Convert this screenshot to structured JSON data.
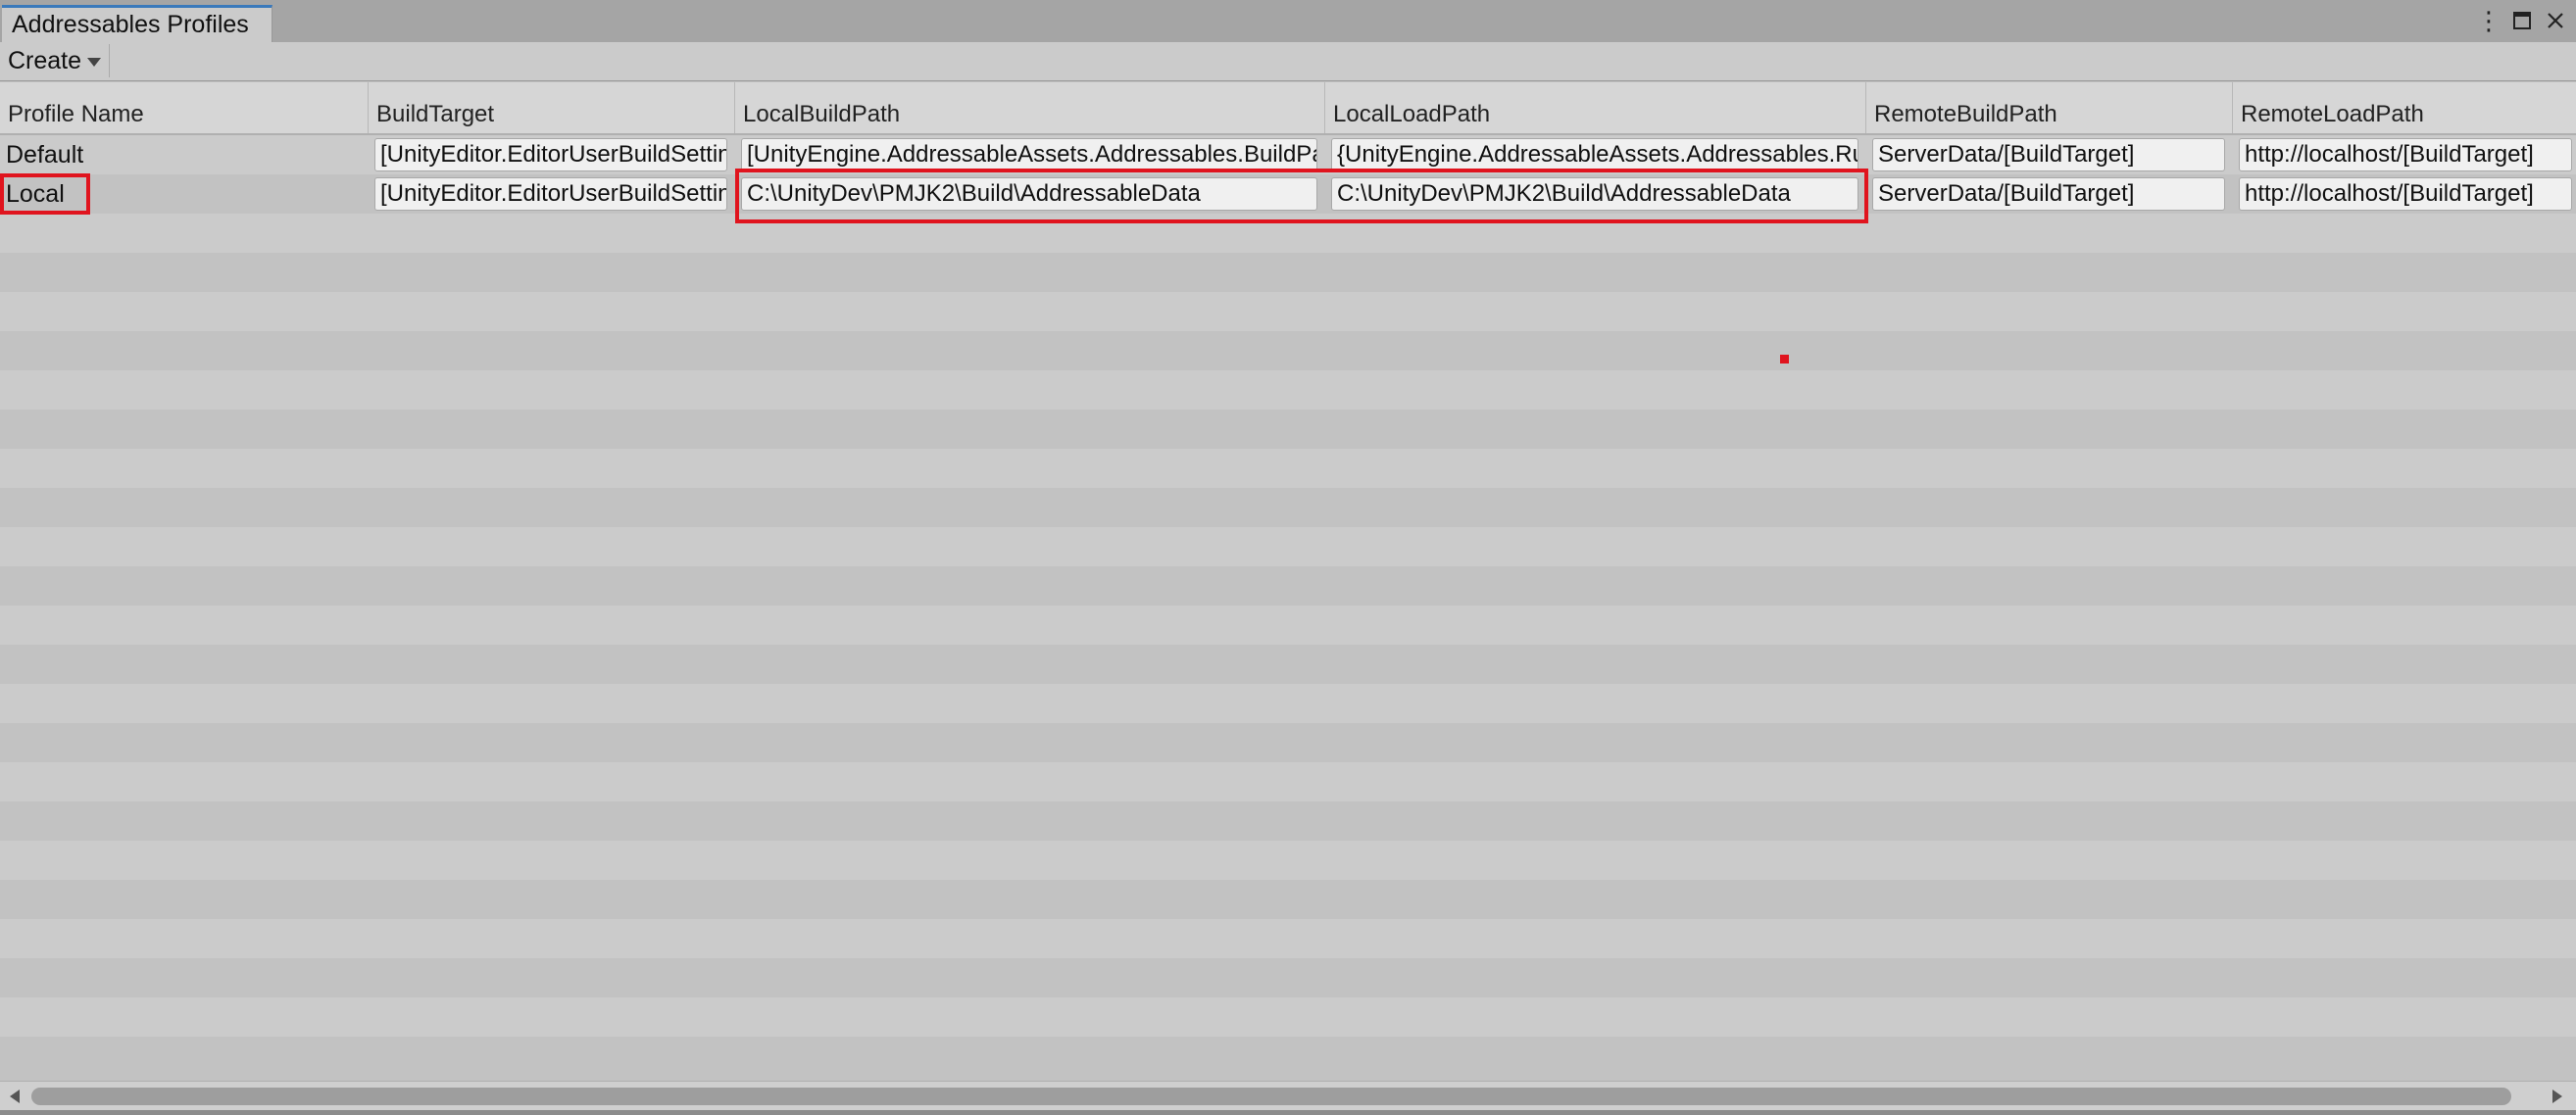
{
  "window": {
    "tab_title": "Addressables Profiles"
  },
  "toolbar": {
    "create_label": "Create"
  },
  "columns": [
    "Profile Name",
    "BuildTarget",
    "LocalBuildPath",
    "LocalLoadPath",
    "RemoteBuildPath",
    "RemoteLoadPath"
  ],
  "rows": [
    {
      "name": "Default",
      "build_target": "[UnityEditor.EditorUserBuildSettings.activeBuildTarget]",
      "local_build_path": "[UnityEngine.AddressableAssets.Addressables.BuildPath]/[BuildTarget]",
      "local_load_path": "{UnityEngine.AddressableAssets.Addressables.RuntimePath}/[BuildTarget]",
      "remote_build_path": "ServerData/[BuildTarget]",
      "remote_load_path": "http://localhost/[BuildTarget]"
    },
    {
      "name": "Local",
      "build_target": "[UnityEditor.EditorUserBuildSettings.activeBuildTarget]",
      "local_build_path": "C:\\UnityDev\\PMJK2\\Build\\AddressableData",
      "local_load_path": "C:\\UnityDev\\PMJK2\\Build\\AddressableData",
      "remote_build_path": "ServerData/[BuildTarget]",
      "remote_load_path": "http://localhost/[BuildTarget]"
    }
  ],
  "colors": {
    "highlight": "#e0141e",
    "tab_accent": "#3a79bb",
    "stripe_light": "#cbcbcb",
    "stripe_dark": "#c2c2c2"
  },
  "icons": {
    "menu": "kebab-menu-icon",
    "maximize": "maximize-icon",
    "close": "close-icon"
  }
}
